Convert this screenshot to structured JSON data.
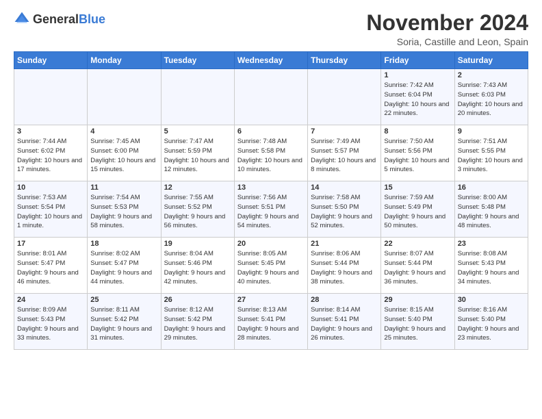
{
  "logo": {
    "general": "General",
    "blue": "Blue"
  },
  "title": "November 2024",
  "subtitle": "Soria, Castille and Leon, Spain",
  "headers": [
    "Sunday",
    "Monday",
    "Tuesday",
    "Wednesday",
    "Thursday",
    "Friday",
    "Saturday"
  ],
  "weeks": [
    [
      {
        "day": "",
        "info": ""
      },
      {
        "day": "",
        "info": ""
      },
      {
        "day": "",
        "info": ""
      },
      {
        "day": "",
        "info": ""
      },
      {
        "day": "",
        "info": ""
      },
      {
        "day": "1",
        "info": "Sunrise: 7:42 AM\nSunset: 6:04 PM\nDaylight: 10 hours and 22 minutes."
      },
      {
        "day": "2",
        "info": "Sunrise: 7:43 AM\nSunset: 6:03 PM\nDaylight: 10 hours and 20 minutes."
      }
    ],
    [
      {
        "day": "3",
        "info": "Sunrise: 7:44 AM\nSunset: 6:02 PM\nDaylight: 10 hours and 17 minutes."
      },
      {
        "day": "4",
        "info": "Sunrise: 7:45 AM\nSunset: 6:00 PM\nDaylight: 10 hours and 15 minutes."
      },
      {
        "day": "5",
        "info": "Sunrise: 7:47 AM\nSunset: 5:59 PM\nDaylight: 10 hours and 12 minutes."
      },
      {
        "day": "6",
        "info": "Sunrise: 7:48 AM\nSunset: 5:58 PM\nDaylight: 10 hours and 10 minutes."
      },
      {
        "day": "7",
        "info": "Sunrise: 7:49 AM\nSunset: 5:57 PM\nDaylight: 10 hours and 8 minutes."
      },
      {
        "day": "8",
        "info": "Sunrise: 7:50 AM\nSunset: 5:56 PM\nDaylight: 10 hours and 5 minutes."
      },
      {
        "day": "9",
        "info": "Sunrise: 7:51 AM\nSunset: 5:55 PM\nDaylight: 10 hours and 3 minutes."
      }
    ],
    [
      {
        "day": "10",
        "info": "Sunrise: 7:53 AM\nSunset: 5:54 PM\nDaylight: 10 hours and 1 minute."
      },
      {
        "day": "11",
        "info": "Sunrise: 7:54 AM\nSunset: 5:53 PM\nDaylight: 9 hours and 58 minutes."
      },
      {
        "day": "12",
        "info": "Sunrise: 7:55 AM\nSunset: 5:52 PM\nDaylight: 9 hours and 56 minutes."
      },
      {
        "day": "13",
        "info": "Sunrise: 7:56 AM\nSunset: 5:51 PM\nDaylight: 9 hours and 54 minutes."
      },
      {
        "day": "14",
        "info": "Sunrise: 7:58 AM\nSunset: 5:50 PM\nDaylight: 9 hours and 52 minutes."
      },
      {
        "day": "15",
        "info": "Sunrise: 7:59 AM\nSunset: 5:49 PM\nDaylight: 9 hours and 50 minutes."
      },
      {
        "day": "16",
        "info": "Sunrise: 8:00 AM\nSunset: 5:48 PM\nDaylight: 9 hours and 48 minutes."
      }
    ],
    [
      {
        "day": "17",
        "info": "Sunrise: 8:01 AM\nSunset: 5:47 PM\nDaylight: 9 hours and 46 minutes."
      },
      {
        "day": "18",
        "info": "Sunrise: 8:02 AM\nSunset: 5:47 PM\nDaylight: 9 hours and 44 minutes."
      },
      {
        "day": "19",
        "info": "Sunrise: 8:04 AM\nSunset: 5:46 PM\nDaylight: 9 hours and 42 minutes."
      },
      {
        "day": "20",
        "info": "Sunrise: 8:05 AM\nSunset: 5:45 PM\nDaylight: 9 hours and 40 minutes."
      },
      {
        "day": "21",
        "info": "Sunrise: 8:06 AM\nSunset: 5:44 PM\nDaylight: 9 hours and 38 minutes."
      },
      {
        "day": "22",
        "info": "Sunrise: 8:07 AM\nSunset: 5:44 PM\nDaylight: 9 hours and 36 minutes."
      },
      {
        "day": "23",
        "info": "Sunrise: 8:08 AM\nSunset: 5:43 PM\nDaylight: 9 hours and 34 minutes."
      }
    ],
    [
      {
        "day": "24",
        "info": "Sunrise: 8:09 AM\nSunset: 5:43 PM\nDaylight: 9 hours and 33 minutes."
      },
      {
        "day": "25",
        "info": "Sunrise: 8:11 AM\nSunset: 5:42 PM\nDaylight: 9 hours and 31 minutes."
      },
      {
        "day": "26",
        "info": "Sunrise: 8:12 AM\nSunset: 5:42 PM\nDaylight: 9 hours and 29 minutes."
      },
      {
        "day": "27",
        "info": "Sunrise: 8:13 AM\nSunset: 5:41 PM\nDaylight: 9 hours and 28 minutes."
      },
      {
        "day": "28",
        "info": "Sunrise: 8:14 AM\nSunset: 5:41 PM\nDaylight: 9 hours and 26 minutes."
      },
      {
        "day": "29",
        "info": "Sunrise: 8:15 AM\nSunset: 5:40 PM\nDaylight: 9 hours and 25 minutes."
      },
      {
        "day": "30",
        "info": "Sunrise: 8:16 AM\nSunset: 5:40 PM\nDaylight: 9 hours and 23 minutes."
      }
    ]
  ]
}
